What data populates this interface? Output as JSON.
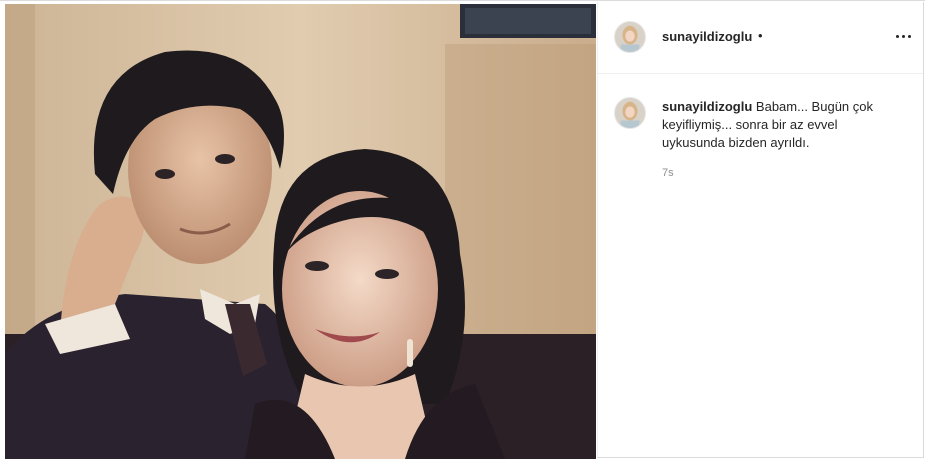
{
  "post": {
    "username": "sunayildizoglu",
    "separator": "•",
    "more_icon": "more-horizontal-icon",
    "photo_alt": "Vintage sepia photo of a man in a suit and tie with dark hair, chin resting on his hand, beside a smiling woman with dark hair and drop earrings"
  },
  "comment": {
    "username": "sunayildizoglu",
    "text": "Babam... Bugün çok keyifliymiş... sonra bir az evvel uykusunda bizden ayrıldı.",
    "time": "7s"
  }
}
